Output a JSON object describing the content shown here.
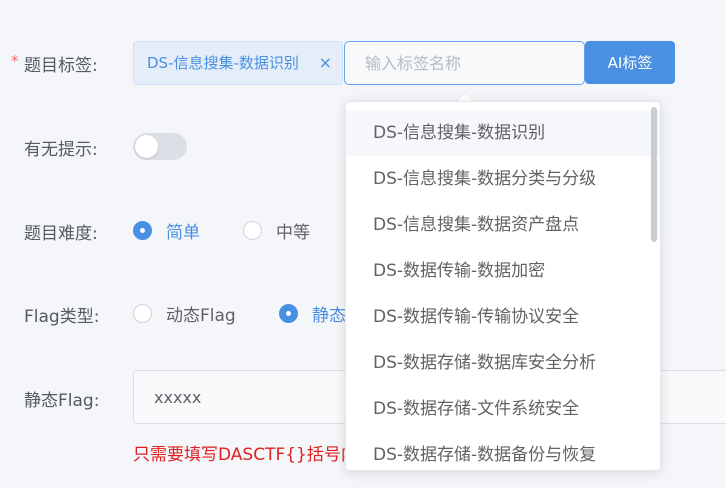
{
  "form": {
    "tags": {
      "required_mark": "*",
      "label": "题目标签:",
      "selected_tag": "DS-信息搜集-数据识别",
      "close_glyph": "×",
      "input_placeholder": "输入标签名称",
      "ai_button": "AI标签"
    },
    "hint_switch": {
      "label": "有无提示:",
      "value": false
    },
    "difficulty": {
      "label": "题目难度:",
      "options": [
        "简单",
        "中等"
      ],
      "selected": "简单"
    },
    "flag_type": {
      "label": "Flag类型:",
      "options": [
        "动态Flag",
        "静态"
      ],
      "selected": "静态"
    },
    "static_flag": {
      "label": "静态Flag:",
      "value": "xxxxx",
      "hint": "只需要填写DASCTF{}括号内"
    }
  },
  "dropdown": {
    "items": [
      "DS-信息搜集-数据识别",
      "DS-信息搜集-数据分类与分级",
      "DS-信息搜集-数据资产盘点",
      "DS-数据传输-数据加密",
      "DS-数据传输-传输协议安全",
      "DS-数据存储-数据库安全分析",
      "DS-数据存储-文件系统安全",
      "DS-数据存储-数据备份与恢复"
    ]
  },
  "colors": {
    "primary": "#4a90e2",
    "required": "#f56c6c",
    "hint_text": "#e02020"
  }
}
